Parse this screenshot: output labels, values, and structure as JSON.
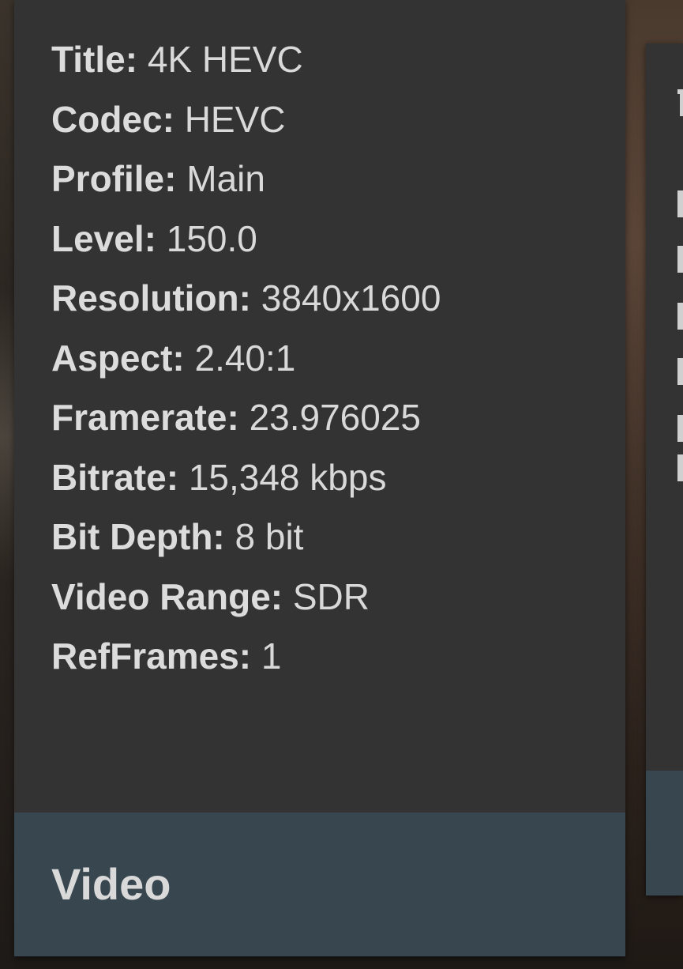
{
  "video_card": {
    "rows": [
      {
        "label": "Title:",
        "value": "4K HEVC"
      },
      {
        "label": "Codec:",
        "value": "HEVC"
      },
      {
        "label": "Profile:",
        "value": "Main"
      },
      {
        "label": "Level:",
        "value": "150.0"
      },
      {
        "label": "Resolution:",
        "value": "3840x1600"
      },
      {
        "label": "Aspect:",
        "value": "2.40:1"
      },
      {
        "label": "Framerate:",
        "value": "23.976025"
      },
      {
        "label": "Bitrate:",
        "value": "15,348 kbps"
      },
      {
        "label": "Bit Depth:",
        "value": "8 bit"
      },
      {
        "label": "Video Range:",
        "value": "SDR"
      },
      {
        "label": "RefFrames:",
        "value": "1"
      }
    ],
    "footer_title": "Video"
  },
  "colors": {
    "card_background": "#333333",
    "footer_background": "#37464f",
    "text": "#d9d9d9"
  }
}
